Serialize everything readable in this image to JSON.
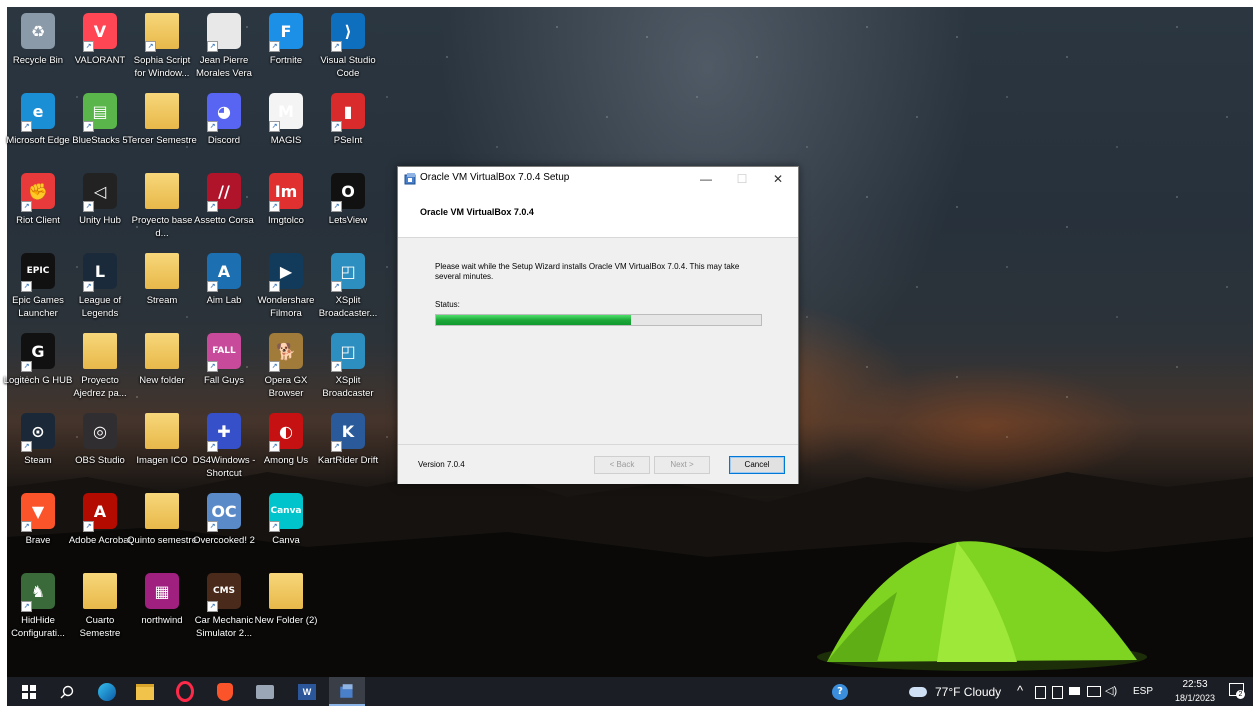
{
  "desktop": {
    "icons": [
      {
        "label": "Recycle Bin"
      },
      {
        "label": "VALORANT"
      },
      {
        "label": "Sophia Script for Window..."
      },
      {
        "label": "Jean Pierre Morales Vera"
      },
      {
        "label": "Fortnite"
      },
      {
        "label": "Visual Studio Code"
      },
      {
        "label": "Microsoft Edge"
      },
      {
        "label": "BlueStacks 5"
      },
      {
        "label": "Tercer Semestre"
      },
      {
        "label": "Discord"
      },
      {
        "label": "MAGIS"
      },
      {
        "label": "PSeInt"
      },
      {
        "label": "Riot Client"
      },
      {
        "label": "Unity Hub"
      },
      {
        "label": "Proyecto base d..."
      },
      {
        "label": "Assetto Corsa"
      },
      {
        "label": "Imgtolco"
      },
      {
        "label": "LetsView"
      },
      {
        "label": "Epic Games Launcher"
      },
      {
        "label": "League of Legends"
      },
      {
        "label": "Stream"
      },
      {
        "label": "Aim Lab"
      },
      {
        "label": "Wondershare Filmora"
      },
      {
        "label": "XSplit Broadcaster..."
      },
      {
        "label": "Logitech G HUB"
      },
      {
        "label": "Proyecto Ajedrez pa..."
      },
      {
        "label": "New folder"
      },
      {
        "label": "Fall Guys"
      },
      {
        "label": "Opera GX Browser"
      },
      {
        "label": "XSplit Broadcaster"
      },
      {
        "label": "Steam"
      },
      {
        "label": "OBS Studio"
      },
      {
        "label": "Imagen ICO"
      },
      {
        "label": "DS4Windows - Shortcut"
      },
      {
        "label": "Among Us"
      },
      {
        "label": "KartRider Drift"
      },
      {
        "label": "Brave"
      },
      {
        "label": "Adobe Acrobat"
      },
      {
        "label": "Quinto semestre"
      },
      {
        "label": "Overcooked! 2"
      },
      {
        "label": "Canva"
      },
      {
        "label": "HidHide Configurati..."
      },
      {
        "label": "Cuarto Semestre"
      },
      {
        "label": "northwind"
      },
      {
        "label": "Car Mechanic Simulator 2..."
      },
      {
        "label": "New Folder (2)"
      }
    ]
  },
  "dialog": {
    "title": "Oracle VM VirtualBox 7.0.4 Setup",
    "header_title": "Oracle VM VirtualBox 7.0.4",
    "message": "Please wait while the Setup Wizard installs Oracle VM VirtualBox 7.0.4. This may take several minutes.",
    "status_label": "Status:",
    "progress": 0.6,
    "version": "Version 7.0.4",
    "back_label": "< Back",
    "next_label": "Next >",
    "cancel_label": "Cancel",
    "minimize_glyph": "—",
    "maximize_glyph": "☐",
    "close_glyph": "✕"
  },
  "taskbar": {
    "weather": "77°F  Cloudy",
    "language": "ESP",
    "time": "22:53",
    "date": "18/1/2023",
    "notification_count": "2"
  },
  "colors": {
    "progress_green": "#1fa83a",
    "taskbar_bg": "#1b1e24",
    "accent": "#0078d7"
  }
}
